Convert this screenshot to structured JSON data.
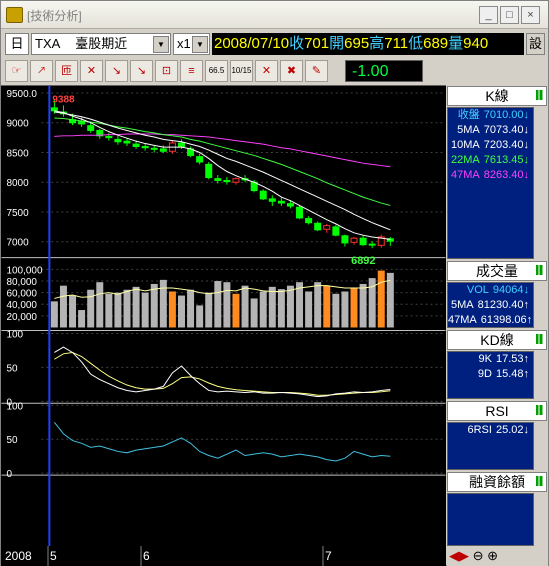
{
  "window": {
    "title": "[技術分析]",
    "min": "_",
    "max": "□",
    "close": "×"
  },
  "toolbar": {
    "period": "日",
    "symbol": "TXA",
    "symbol_name": "臺股期近",
    "zoom": "x1",
    "date": "2008/07/10",
    "quote": [
      {
        "label": "收",
        "value": "701"
      },
      {
        "label": "開",
        "value": "695"
      },
      {
        "label": "高",
        "value": "711"
      },
      {
        "label": "低",
        "value": "689"
      },
      {
        "label": "量",
        "value": "940"
      }
    ],
    "mode_button": "設",
    "change_value": "-1.00",
    "icon_labels": [
      "",
      "",
      "",
      "",
      "",
      "",
      "",
      "",
      "66.5",
      "10/15",
      "",
      "",
      ""
    ]
  },
  "panels": {
    "k": {
      "title": "K線",
      "lines": [
        {
          "label": "收盤",
          "value": "7010.00",
          "arrow": "↓",
          "color": "#40d0ff"
        },
        {
          "label": "5MA",
          "value": "7073.40",
          "arrow": "↓",
          "color": "#ffffff"
        },
        {
          "label": "10MA",
          "value": "7203.40",
          "arrow": "↓",
          "color": "#ffffff"
        },
        {
          "label": "22MA",
          "value": "7613.45",
          "arrow": "↓",
          "color": "#40ff40"
        },
        {
          "label": "47MA",
          "value": "8263.40",
          "arrow": "↓",
          "color": "#ff40ff"
        }
      ],
      "high_label": "9388",
      "low_label": "6892"
    },
    "volume": {
      "title": "成交量",
      "lines": [
        {
          "label": "VOL",
          "value": "94064",
          "arrow": "↓",
          "color": "#40d0ff"
        },
        {
          "label": "5MA",
          "value": "81230.40",
          "arrow": "↑",
          "color": "#ffffff"
        },
        {
          "label": "47MA",
          "value": "61398.06",
          "arrow": "↑",
          "color": "#ffffff"
        }
      ]
    },
    "kd": {
      "title": "KD線",
      "lines": [
        {
          "label": "9K",
          "value": "17.53",
          "arrow": "↑",
          "color": "#ffffff"
        },
        {
          "label": "9D",
          "value": "15.48",
          "arrow": "↑",
          "color": "#ffffff"
        }
      ]
    },
    "rsi": {
      "title": "RSI",
      "lines": [
        {
          "label": "6RSI",
          "value": "25.02",
          "arrow": "↓",
          "color": "#ffffff"
        }
      ]
    },
    "margin": {
      "title": "融資餘額",
      "lines": []
    }
  },
  "axes": {
    "price_ticks": [
      "9500.0",
      "9000",
      "8500",
      "8000",
      "7500",
      "7000"
    ],
    "volume_ticks": [
      "100,000",
      "80,000",
      "60,000",
      "40,000",
      "20,000"
    ],
    "kd_ticks": [
      "100",
      "50",
      "0"
    ],
    "rsi_ticks": [
      "100",
      "50",
      "0"
    ],
    "date_labels": [
      "2008",
      "5",
      "6",
      "7"
    ]
  },
  "colors": {
    "up": "#ff3030",
    "down": "#00ff00",
    "ma5": "#ffffff",
    "ma22": "#40ff40",
    "ma47": "#ff40ff",
    "vol_up": "#ff8a20",
    "vol_down": "#b4b4b4",
    "kd_k": "#ffffff",
    "kd_d": "#ffff80",
    "rsi": "#40c0e0",
    "quote_label": "#40d0ff",
    "quote_value": "#ffff00"
  },
  "chart_data": {
    "type": "candlestick",
    "price": {
      "ylim": [
        6800,
        9550
      ],
      "candles": [
        [
          9250,
          9388,
          9150,
          9200
        ],
        [
          9180,
          9290,
          9100,
          9150
        ],
        [
          9050,
          9150,
          8960,
          9000
        ],
        [
          9020,
          9090,
          8930,
          8980
        ],
        [
          8950,
          9020,
          8830,
          8870
        ],
        [
          8870,
          8900,
          8730,
          8780
        ],
        [
          8770,
          8830,
          8700,
          8750
        ],
        [
          8720,
          8780,
          8630,
          8680
        ],
        [
          8690,
          8740,
          8610,
          8660
        ],
        [
          8640,
          8700,
          8560,
          8600
        ],
        [
          8600,
          8650,
          8530,
          8580
        ],
        [
          8570,
          8610,
          8500,
          8560
        ],
        [
          8560,
          8620,
          8490,
          8520
        ],
        [
          8520,
          8700,
          8480,
          8660
        ],
        [
          8660,
          8720,
          8560,
          8600
        ],
        [
          8560,
          8600,
          8420,
          8450
        ],
        [
          8430,
          8480,
          8300,
          8340
        ],
        [
          8300,
          8340,
          8050,
          8080
        ],
        [
          8060,
          8120,
          7980,
          8030
        ],
        [
          8030,
          8090,
          7960,
          8010
        ],
        [
          8000,
          8080,
          7960,
          8060
        ],
        [
          8060,
          8120,
          8000,
          8040
        ],
        [
          8000,
          8040,
          7830,
          7860
        ],
        [
          7850,
          7880,
          7700,
          7720
        ],
        [
          7720,
          7780,
          7600,
          7680
        ],
        [
          7680,
          7740,
          7600,
          7650
        ],
        [
          7640,
          7700,
          7560,
          7600
        ],
        [
          7580,
          7620,
          7380,
          7400
        ],
        [
          7390,
          7430,
          7290,
          7320
        ],
        [
          7310,
          7340,
          7180,
          7200
        ],
        [
          7210,
          7300,
          7150,
          7270
        ],
        [
          7250,
          7280,
          7090,
          7110
        ],
        [
          7100,
          7120,
          6920,
          6980
        ],
        [
          6990,
          7080,
          6950,
          7060
        ],
        [
          7060,
          7110,
          6930,
          6950
        ],
        [
          6960,
          7010,
          6892,
          6950
        ],
        [
          6940,
          7120,
          6900,
          7080
        ],
        [
          7050,
          7080,
          6930,
          7010
        ]
      ],
      "ma5": [
        9200,
        9170,
        9110,
        9060,
        9000,
        8920,
        8850,
        8790,
        8740,
        8690,
        8650,
        8620,
        8590,
        8590,
        8590,
        8560,
        8500,
        8400,
        8280,
        8180,
        8110,
        8050,
        8000,
        7930,
        7850,
        7750,
        7690,
        7610,
        7530,
        7450,
        7370,
        7300,
        7220,
        7150,
        7110,
        7080,
        7060,
        7040
      ],
      "ma10": [
        9180,
        9160,
        9130,
        9100,
        9060,
        9010,
        8960,
        8910,
        8870,
        8830,
        8790,
        8760,
        8720,
        8700,
        8680,
        8640,
        8600,
        8540,
        8470,
        8400,
        8350,
        8290,
        8230,
        8170,
        8100,
        8030,
        7960,
        7890,
        7820,
        7750,
        7680,
        7610,
        7540,
        7460,
        7390,
        7320,
        7260,
        7200
      ],
      "ma22": [
        9080,
        9070,
        9050,
        9030,
        9010,
        8990,
        8960,
        8930,
        8910,
        8880,
        8850,
        8830,
        8800,
        8780,
        8760,
        8720,
        8690,
        8650,
        8610,
        8570,
        8530,
        8490,
        8450,
        8400,
        8350,
        8300,
        8240,
        8180,
        8120,
        8060,
        7990,
        7930,
        7870,
        7810,
        7750,
        7700,
        7650,
        7610
      ],
      "ma47": [
        8770,
        8780,
        8780,
        8790,
        8790,
        8790,
        8800,
        8800,
        8810,
        8810,
        8810,
        8810,
        8800,
        8800,
        8790,
        8780,
        8770,
        8760,
        8740,
        8720,
        8700,
        8680,
        8660,
        8640,
        8610,
        8580,
        8560,
        8530,
        8500,
        8470,
        8440,
        8410,
        8380,
        8350,
        8320,
        8300,
        8280,
        8260
      ]
    },
    "volume": {
      "ylim": [
        0,
        110000
      ],
      "values": [
        45000,
        72000,
        55000,
        30000,
        65000,
        78000,
        58000,
        60000,
        65000,
        70000,
        60000,
        75000,
        82000,
        62000,
        55000,
        65000,
        38000,
        60000,
        80000,
        78000,
        58000,
        72000,
        50000,
        62000,
        70000,
        66000,
        72000,
        78000,
        62000,
        78000,
        72000,
        58000,
        62000,
        68000,
        75000,
        85000,
        98000,
        94064
      ],
      "ma5": [
        50000,
        54000,
        56000,
        52000,
        53000,
        58000,
        60000,
        57000,
        62000,
        66000,
        63000,
        66000,
        68000,
        68000,
        66000,
        64000,
        60000,
        58000,
        60000,
        64000,
        63000,
        68000,
        66000,
        63000,
        62000,
        62000,
        64000,
        68000,
        70000,
        72000,
        72000,
        70000,
        68000,
        68000,
        68000,
        70000,
        78000,
        81230
      ]
    },
    "kd": {
      "ylim": [
        0,
        100
      ],
      "k": [
        72,
        80,
        72,
        58,
        40,
        32,
        26,
        20,
        16,
        14,
        16,
        18,
        22,
        42,
        52,
        38,
        26,
        16,
        14,
        15,
        14,
        13,
        14,
        12,
        12,
        13,
        12,
        11,
        9,
        7,
        8,
        11,
        12,
        14,
        13,
        14,
        16,
        17.5
      ],
      "d": [
        62,
        70,
        72,
        66,
        56,
        46,
        37,
        30,
        24,
        20,
        18,
        18,
        19,
        26,
        35,
        36,
        33,
        27,
        22,
        19,
        17,
        16,
        15,
        14,
        13,
        13,
        13,
        12,
        11,
        9,
        9,
        10,
        11,
        12,
        13,
        13,
        14,
        15.5
      ]
    },
    "rsi": {
      "ylim": [
        0,
        100
      ],
      "values": [
        75,
        58,
        48,
        44,
        38,
        40,
        36,
        32,
        30,
        34,
        36,
        38,
        40,
        46,
        52,
        44,
        32,
        26,
        22,
        28,
        34,
        26,
        28,
        30,
        28,
        24,
        26,
        28,
        26,
        24,
        20,
        18,
        22,
        32,
        28,
        24,
        26,
        25
      ]
    }
  }
}
